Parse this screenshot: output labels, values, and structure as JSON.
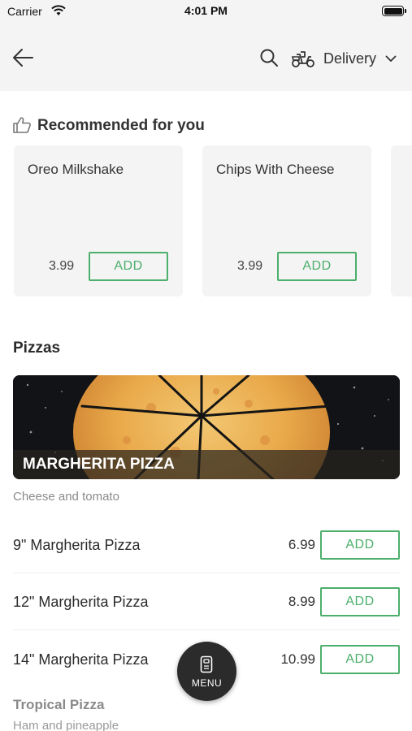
{
  "status_bar": {
    "carrier": "Carrier",
    "time": "4:01 PM"
  },
  "header": {
    "back_icon": "arrow-left-icon",
    "search_icon": "search-icon",
    "delivery_icon": "scooter-icon",
    "delivery_label": "Delivery",
    "chevron_icon": "chevron-down-icon"
  },
  "recommended": {
    "title": "Recommended for you",
    "icon": "thumbs-up-icon",
    "items": [
      {
        "name": "Oreo Milkshake",
        "price": "3.99",
        "add_label": "ADD"
      },
      {
        "name": "Chips With Cheese",
        "price": "3.99",
        "add_label": "ADD"
      }
    ]
  },
  "pizzas": {
    "title": "Pizzas",
    "banner_title": "MARGHERITA PIZZA",
    "banner_description": "Cheese and tomato",
    "items": [
      {
        "name": "9\" Margherita Pizza",
        "price": "6.99",
        "add_label": "ADD"
      },
      {
        "name": "12\" Margherita Pizza",
        "price": "8.99",
        "add_label": "ADD"
      },
      {
        "name": "14\" Margherita Pizza",
        "price": "10.99",
        "add_label": "ADD"
      }
    ],
    "next_item": {
      "name": "Tropical Pizza",
      "description": "Ham and pineapple"
    }
  },
  "menu_button": {
    "label": "MENU",
    "icon": "menu-card-icon"
  },
  "colors": {
    "accent": "#4caf6b",
    "header_bg": "#f4f4f4",
    "fab_bg": "#2b2b2b"
  }
}
